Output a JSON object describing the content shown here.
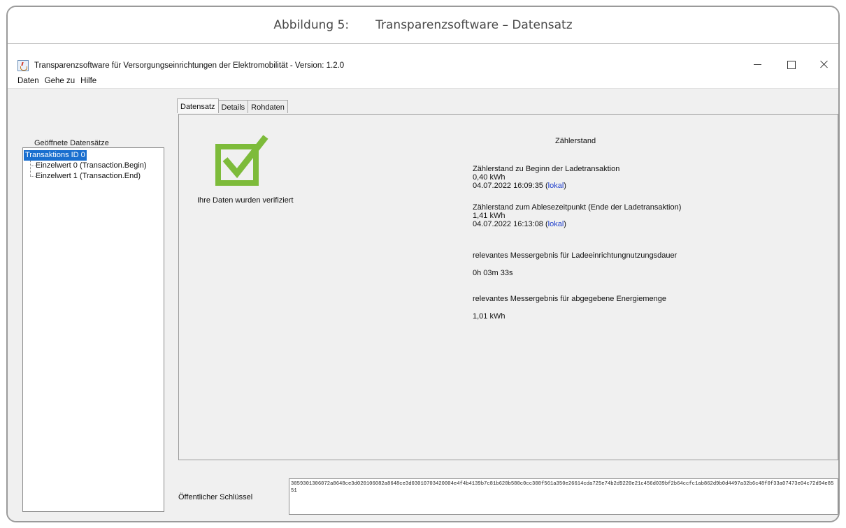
{
  "caption": {
    "number": "Abbildung 5:",
    "title": "Transparenzsoftware – Datensatz"
  },
  "window": {
    "title": "Transparenzsoftware für Versorgungseinrichtungen der Elektromobilität - Version: 1.2.0",
    "minimize": "—",
    "maximize": "☐",
    "close": "✕"
  },
  "menu": [
    "Daten",
    "Gehe zu",
    "Hilfe"
  ],
  "sidebar": {
    "title": "Geöffnete Datensätze",
    "root": "Transaktions ID 0",
    "children": [
      "Einzelwert 0 (Transaction.Begin)",
      "Einzelwert 1 (Transaction.End)"
    ]
  },
  "tabs": [
    "Datensatz",
    "Details",
    "Rohdaten"
  ],
  "active_tab": "Datensatz",
  "verification": {
    "icon": "check-icon",
    "color": "#7dbb3a",
    "message": "Ihre Daten wurden verifiziert"
  },
  "meter": {
    "title": "Zählerstand",
    "begin": {
      "label": "Zählerstand zu Beginn der Ladetransaktion",
      "value": "0,40 kWh",
      "timestamp": "04.07.2022 16:09:35 (",
      "link": "lokal",
      "close": ")"
    },
    "end": {
      "label": "Zählerstand zum Ablesezeitpunkt (Ende der Ladetransaktion)",
      "value": "1,41 kWh",
      "timestamp": "04.07.2022 16:13:08 (",
      "link": "lokal",
      "close": ")"
    },
    "duration": {
      "label": "relevantes Messergebnis für Ladeeinrichtungnutzungsdauer",
      "value": "0h 03m 33s"
    },
    "energy": {
      "label": "relevantes Messergebnis für abgegebene Energiemenge",
      "value": "1,01 kWh"
    }
  },
  "public_key": {
    "label": "Öffentlicher Schlüssel",
    "value": "3059301306072a8648ce3d020106082a8648ce3d03010703420004e4f4b4139b7c81b620b580c0cc308f561a350e26614cda725e74b2d9220e21c456d039bf2b64ccfc1ab862d9b0d4497a32b6c48f0f33a07473e04c72d94e8551"
  }
}
